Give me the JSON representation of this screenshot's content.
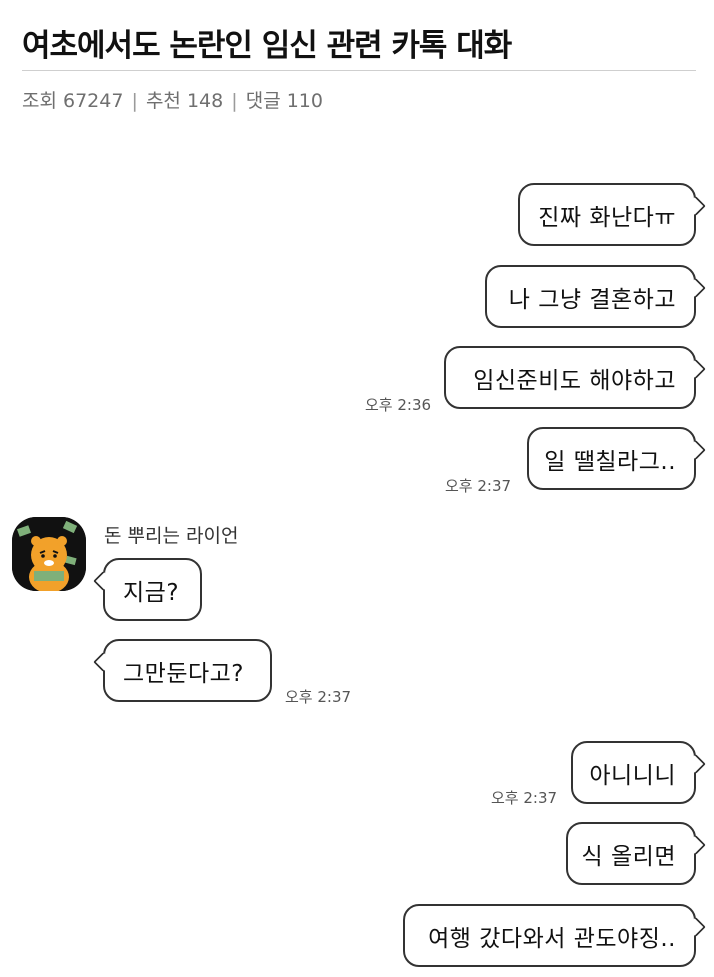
{
  "post": {
    "title": "여초에서도 논란인 임신 관련 카톡 대화",
    "views": "조회 67247",
    "recommends": "추천 148",
    "comments": "댓글 110",
    "separator": "|"
  },
  "chat": {
    "sender_name": "돈 뿌리는 라이언",
    "messages": [
      {
        "from": "me",
        "text": "진짜 화난다ㅠ",
        "time": ""
      },
      {
        "from": "me",
        "text": "나 그냥 결혼하고",
        "time": ""
      },
      {
        "from": "me",
        "text": "임신준비도 해야하고",
        "time": "오후 2:36"
      },
      {
        "from": "me",
        "text": "일 땔칠라그..",
        "time": "오후 2:37"
      },
      {
        "from": "other",
        "text": "지금?",
        "time": ""
      },
      {
        "from": "other",
        "text": "그만둔다고?",
        "time": "오후 2:37"
      },
      {
        "from": "me",
        "text": "아니니니",
        "time": "오후 2:37"
      },
      {
        "from": "me",
        "text": "식 올리면",
        "time": ""
      },
      {
        "from": "me",
        "text": "여행 갔다와서 관도야징..",
        "time": ""
      }
    ]
  },
  "colors": {
    "bubble_border": "#333333",
    "bubble_bg": "#ffffff",
    "avatar_bg": "#111111",
    "character": "#f2a12a"
  },
  "icons": {
    "avatar": "ryan-character-icon"
  }
}
